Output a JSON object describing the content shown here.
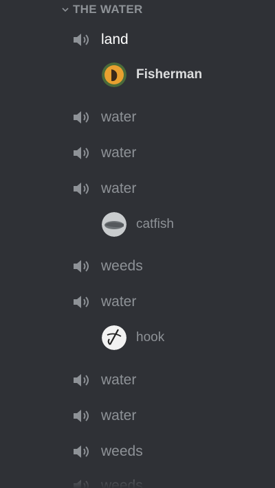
{
  "category": {
    "label": "THE WATER",
    "icon": "chevron-down-icon"
  },
  "channels": [
    {
      "name": "land",
      "active": true,
      "icon": "speaker-icon"
    },
    {
      "name": "water",
      "icon": "speaker-icon"
    },
    {
      "name": "water",
      "icon": "speaker-icon"
    },
    {
      "name": "water",
      "icon": "speaker-icon"
    },
    {
      "name": "weeds",
      "icon": "speaker-icon"
    },
    {
      "name": "water",
      "icon": "speaker-icon"
    },
    {
      "name": "water",
      "icon": "speaker-icon"
    },
    {
      "name": "water",
      "icon": "speaker-icon"
    },
    {
      "name": "weeds",
      "icon": "speaker-icon"
    },
    {
      "name": "weeds",
      "icon": "speaker-icon"
    }
  ],
  "users": [
    {
      "name": "Fisherman",
      "channel": "land",
      "avatar": "fisherman-avatar"
    },
    {
      "name": "catfish",
      "channel": "water",
      "avatar": "catfish-avatar"
    },
    {
      "name": "hook",
      "channel": "water",
      "avatar": "hook-avatar"
    }
  ],
  "colors": {
    "background": "#2f3136",
    "muted_text": "#8e9297",
    "active_text": "#ffffff",
    "user_text": "#dcddde"
  }
}
